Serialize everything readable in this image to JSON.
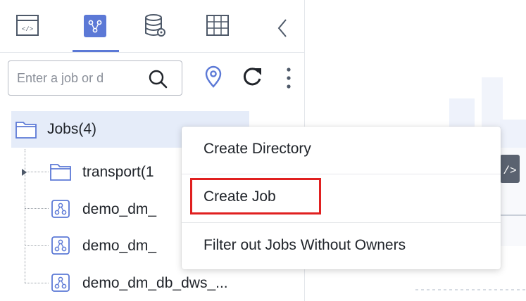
{
  "toolbar": {
    "tabs": [
      {
        "icon": "code-icon",
        "active": false
      },
      {
        "icon": "job-flow-icon",
        "active": true
      },
      {
        "icon": "database-icon",
        "active": false
      },
      {
        "icon": "grid-table-icon",
        "active": false
      }
    ],
    "collapse_icon": "chevron-left-icon",
    "accent_color": "#5c79d6"
  },
  "search": {
    "placeholder": "Enter a job or d",
    "value": ""
  },
  "tree": {
    "root": {
      "label": "Jobs(4)",
      "icon": "folder-icon"
    },
    "children": [
      {
        "label": "transport(1",
        "icon": "folder-icon",
        "expandable": true
      },
      {
        "label": "demo_dm_",
        "icon": "job-node-icon"
      },
      {
        "label": "demo_dm_",
        "icon": "job-node-icon"
      },
      {
        "label": "demo_dm_db_dws_...",
        "icon": "job-node-icon"
      }
    ]
  },
  "context_menu": {
    "items": [
      {
        "label": "Create Directory"
      },
      {
        "label": "Create Job",
        "highlighted": true
      },
      {
        "label": "Filter out Jobs Without Owners"
      }
    ],
    "highlight_color": "#e02020"
  }
}
